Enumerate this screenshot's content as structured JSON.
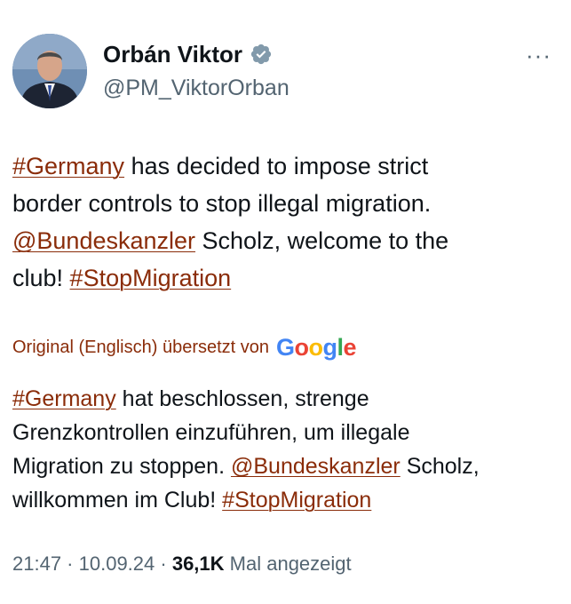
{
  "author": {
    "display_name": "Orbán Viktor",
    "handle": "@PM_ViktorOrban",
    "verified_icon": "verified-badge-icon",
    "avatar": "avatar-photo"
  },
  "more_menu": {
    "label": "···"
  },
  "original": {
    "hashtag_germany": "#Germany",
    "line1_rest": " has decided to impose strict",
    "line2": "border controls to stop illegal migration.",
    "mention": "@Bundeskanzler",
    "line3_rest": " Scholz, welcome to the",
    "line4_start": "club! ",
    "hashtag_stop": "#StopMigration"
  },
  "translation_note": {
    "label": "Original (Englisch) übersetzt von",
    "provider": {
      "G": "G",
      "o1": "o",
      "o2": "o",
      "g": "g",
      "l": "l",
      "e": "e"
    }
  },
  "translation": {
    "hashtag_germany": "#Germany",
    "line1_rest": " hat beschlossen, strenge",
    "line2": "Grenzkontrollen einzuführen, um illegale",
    "line3_start": "Migration zu stoppen. ",
    "mention": "@Bundeskanzler",
    "line3_rest": " Scholz,",
    "line4_start": "willkommen im Club! ",
    "hashtag_stop": "#StopMigration"
  },
  "meta": {
    "time": "21:47",
    "sep1": " · ",
    "date": "10.09.24",
    "sep2": " · ",
    "views_count": "36,1K",
    "views_label": " Mal angezeigt"
  },
  "colors": {
    "link": "#8a2c09",
    "secondary": "#536471",
    "primary": "#0f1419",
    "verified": "#829aab"
  }
}
